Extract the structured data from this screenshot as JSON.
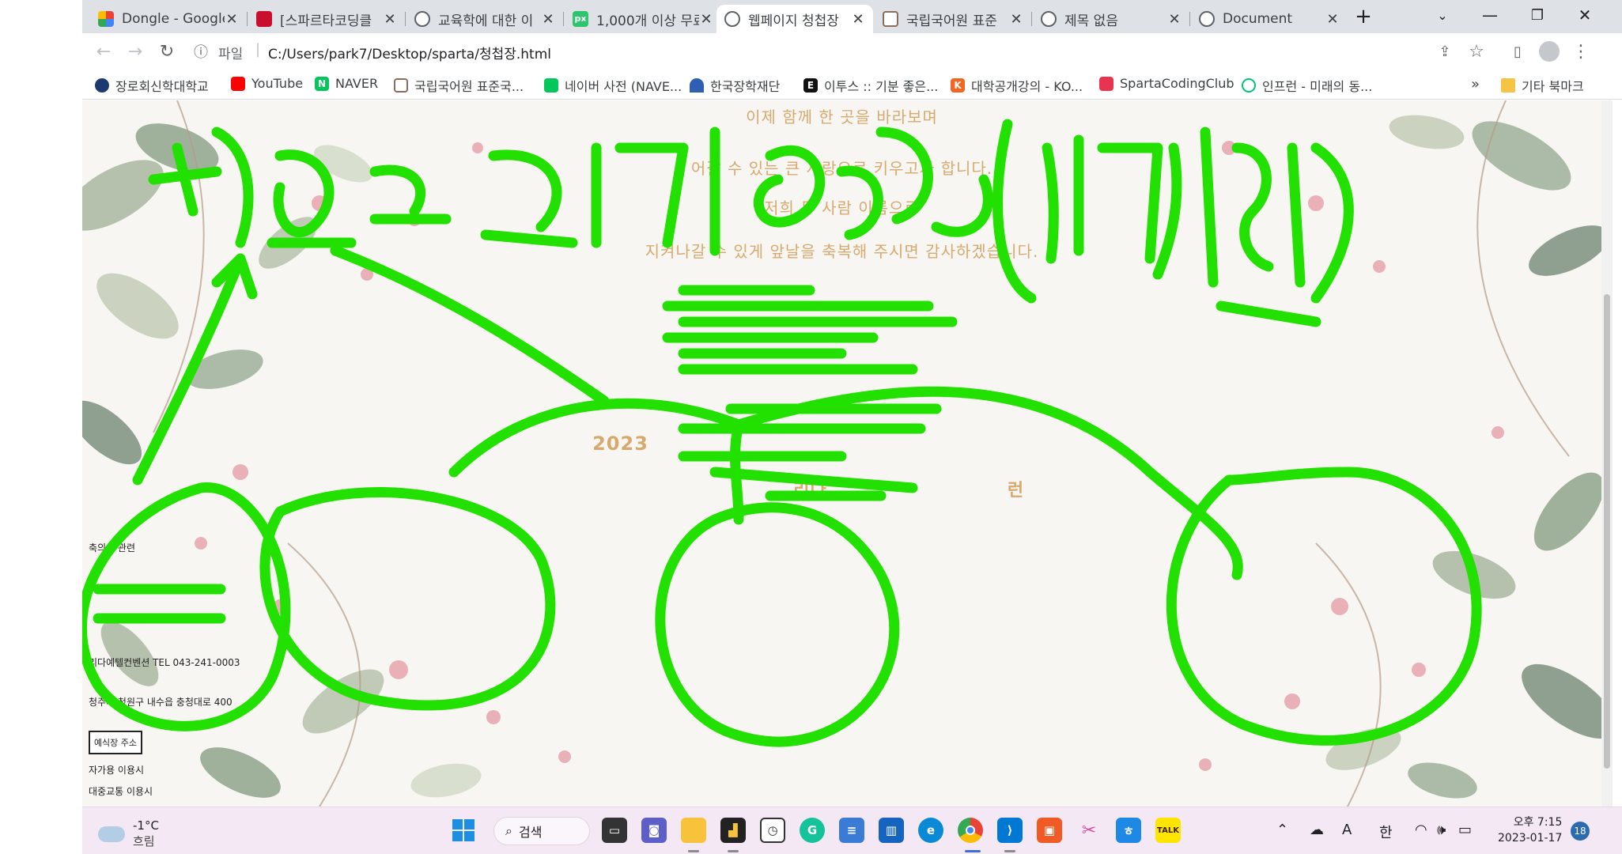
{
  "colors": {
    "scribble": "#22e000",
    "invite_text": "#d8a96e",
    "tabbar_bg": "#dee1e6",
    "taskbar_bg": "#f3e8f3"
  },
  "tabs": [
    {
      "label": "Dongle - Google",
      "icon": "google-fonts-icon",
      "active": false
    },
    {
      "label": "[스파르타코딩클",
      "icon": "sparta-icon",
      "active": false
    },
    {
      "label": "교육학에 대한 이",
      "icon": "globe-icon",
      "active": false
    },
    {
      "label": "1,000개 이상 무료",
      "icon": "px-icon",
      "active": false
    },
    {
      "label": "웹페이지 청첩장",
      "icon": "globe-icon",
      "active": true
    },
    {
      "label": "국립국어원 표준",
      "icon": "korean-institute-icon",
      "active": false
    },
    {
      "label": "제목 없음",
      "icon": "globe-icon",
      "active": false
    },
    {
      "label": "Document",
      "icon": "globe-icon",
      "active": false
    }
  ],
  "toolbar": {
    "url_scheme": "파일",
    "url": "C:/Users/park7/Desktop/sparta/청첩장.html"
  },
  "bookmarks": [
    {
      "label": "장로회신학대학교",
      "icon": "university-icon"
    },
    {
      "label": "YouTube",
      "icon": "youtube-icon"
    },
    {
      "label": "NAVER",
      "icon": "naver-icon"
    },
    {
      "label": "국립국어원 표준국...",
      "icon": "korean-institute-icon"
    },
    {
      "label": "네이버 사전 (NAVE...",
      "icon": "naver-dictionary-icon"
    },
    {
      "label": "한국장학재단",
      "icon": "scholarship-icon"
    },
    {
      "label": "이투스 :: 기분 좋은...",
      "icon": "etoos-icon"
    },
    {
      "label": "대학공개강의 - KO...",
      "icon": "kocw-icon"
    },
    {
      "label": "SpartaCodingClub",
      "icon": "sparta-icon"
    },
    {
      "label": "인프런 - 미래의 동...",
      "icon": "inflearn-icon"
    }
  ],
  "other_bookmarks": "기타 북마크",
  "invitation": {
    "lines": [
      "이제 함께 한 곳을 바라보며",
      "어갈 수 있는 큰 사랑으로 키우고자 합니다.",
      "저희 두 사람 이름으로",
      "지켜나갈 수 있게 앞날을 축복해 주시면 감사하겠습니다."
    ],
    "partial_date": "2023",
    "partial_venue": "리다",
    "partial_trail": "런"
  },
  "sidebar_info": {
    "gift_label": "축의금 관련",
    "venue_tel": "리다예텔컨벤션 TEL 043-241-0003",
    "address": "청주시 청원구 내수읍 충청대로 400",
    "map_button": "예식장 주소",
    "car_label": "자가용 이용시",
    "transit_label": "대중교통 이용시"
  },
  "scribble": {
    "note": "칸으로 꾸미고 싶음(이미지 없애)"
  },
  "taskbar": {
    "weather_temp": "-1°C",
    "weather_desc": "흐림",
    "search_label": "검색",
    "ime_a": "A",
    "ime_lang": "한",
    "time": "오후 7:15",
    "date": "2023-01-17",
    "notif_count": "18"
  }
}
